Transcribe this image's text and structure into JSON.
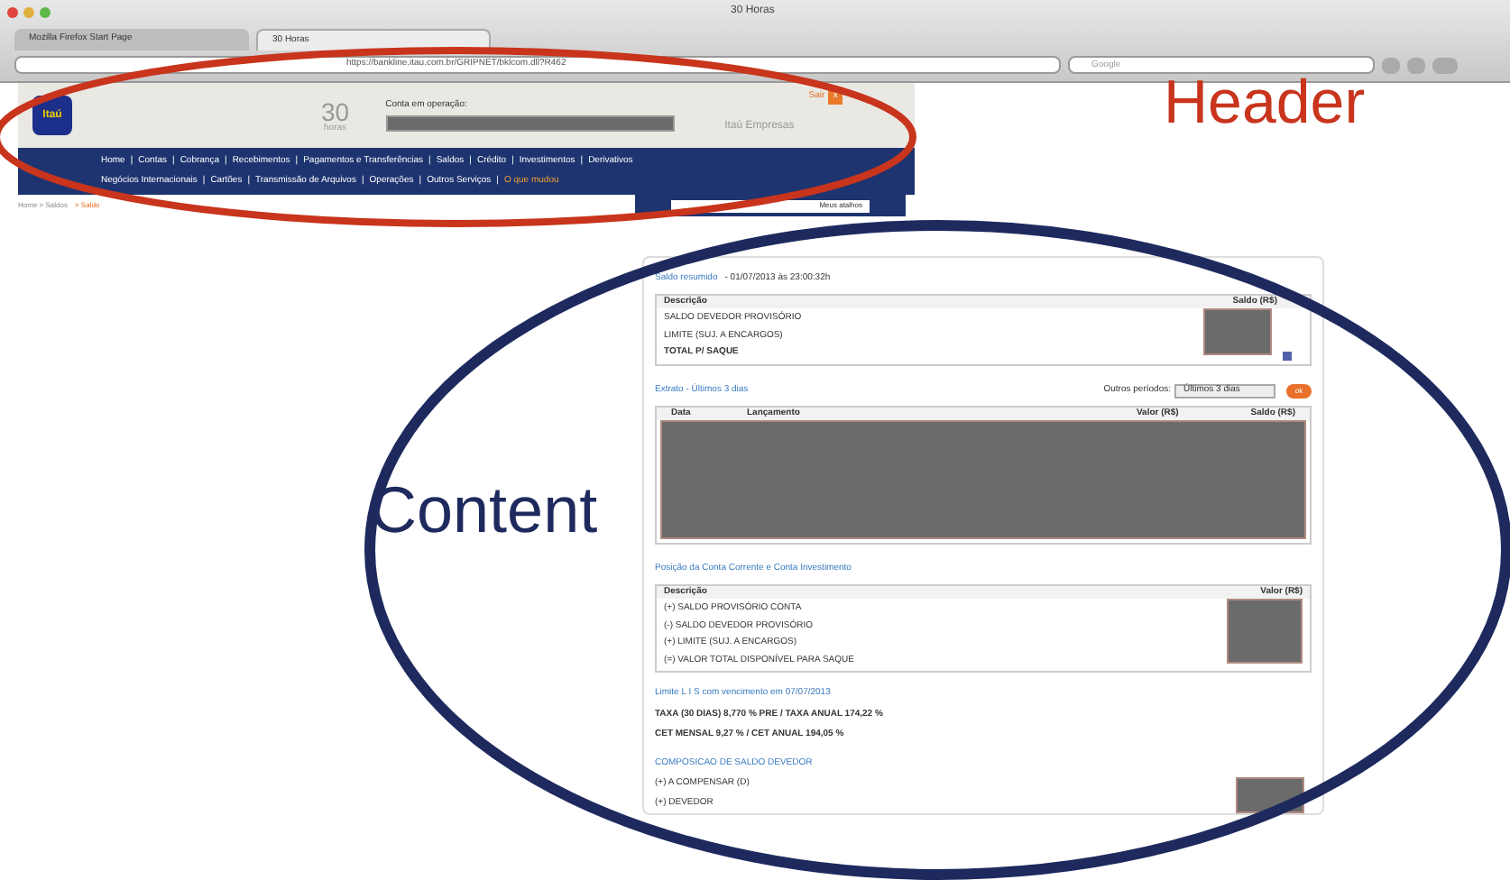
{
  "browser": {
    "title": "30 Horas",
    "tabs": [
      {
        "label": "Mozilla Firefox Start Page",
        "selected": false
      },
      {
        "label": "30 Horas",
        "selected": true
      }
    ],
    "url": "https://bankline.itau.com.br/GRIPNET/bklcom.dll?R462",
    "search_placeholder": "Google"
  },
  "header": {
    "logo": "Itaú",
    "brand_number": "30",
    "brand_word": "horas",
    "account_label": "Conta em operação:",
    "company": "Itaú Empresas",
    "logout": "Sair",
    "logout_icon": "x"
  },
  "nav": {
    "lines": [
      {
        "links": [
          {
            "label": "Home",
            "highlighted": false
          },
          {
            "label": "Contas",
            "highlighted": false
          },
          {
            "label": "Cobrança",
            "highlighted": false
          },
          {
            "label": "Recebimentos",
            "highlighted": false
          },
          {
            "label": "Pagamentos e Transferências",
            "highlighted": false
          },
          {
            "label": "Saldos",
            "highlighted": false
          },
          {
            "label": "Crédito",
            "highlighted": false
          },
          {
            "label": "Investimentos",
            "highlighted": false
          },
          {
            "label": "Derivativos",
            "highlighted": false
          }
        ]
      },
      {
        "links": [
          {
            "label": "Negócios Internacionais",
            "highlighted": false
          },
          {
            "label": "Cartões",
            "highlighted": false
          },
          {
            "label": "Transmissão de Arquivos",
            "highlighted": false
          },
          {
            "label": "Operações",
            "highlighted": false
          },
          {
            "label": "Outros Serviços",
            "highlighted": false
          },
          {
            "label": "O que mudou",
            "highlighted": true
          }
        ]
      }
    ],
    "separator": "|",
    "shortcuts": "Meus atalhos"
  },
  "breadcrumb": "Home > Saldos",
  "breadcrumb_link": "> Saldo",
  "balance": {
    "title": "Saldo resumido",
    "date": "- 01/07/2013 às 23:00:32h",
    "columns": [
      "Descrição",
      "Saldo (R$)"
    ],
    "rows": [
      {
        "label": "SALDO DEVEDOR PROVISÓRIO",
        "bold": false
      },
      {
        "label": "LIMITE (SUJ. A ENCARGOS)",
        "bold": false
      },
      {
        "label": "TOTAL P/ SAQUE",
        "bold": true
      }
    ]
  },
  "statement": {
    "title": "Extrato - Últimos 3 dias",
    "period_label": "Outros períodos:",
    "period": "Últimos 3 dias",
    "ok": "ok",
    "columns": [
      "Data",
      "Lançamento",
      "Valor (R$)",
      "Saldo (R$)"
    ]
  },
  "position": {
    "title": "Posição da Conta Corrente e Conta Investimento",
    "columns": [
      "Descrição",
      "Valor (R$)"
    ],
    "rows": [
      "(+) SALDO PROVISÓRIO CONTA",
      "(-) SALDO DEVEDOR PROVISÓRIO",
      "(+) LIMITE (SUJ. A ENCARGOS)",
      "(=) VALOR TOTAL DISPONÍVEL PARA SAQUE"
    ]
  },
  "limit": {
    "title": "Limite L I S com vencimento em 07/07/2013",
    "lines": [
      "TAXA (30 DIAS) 8,770 % PRE / TAXA ANUAL 174,22 %",
      "CET MENSAL 9,27 % / CET ANUAL 194,05 %"
    ]
  },
  "composition": {
    "title": "COMPOSICAO DE SALDO DEVEDOR",
    "rows": [
      "(+) A COMPENSAR (D)",
      "(+) DEVEDOR"
    ]
  },
  "annotations": [
    {
      "label": "Header",
      "color": "#c8341c"
    },
    {
      "label": "Content",
      "color": "#1e2a5e"
    }
  ]
}
